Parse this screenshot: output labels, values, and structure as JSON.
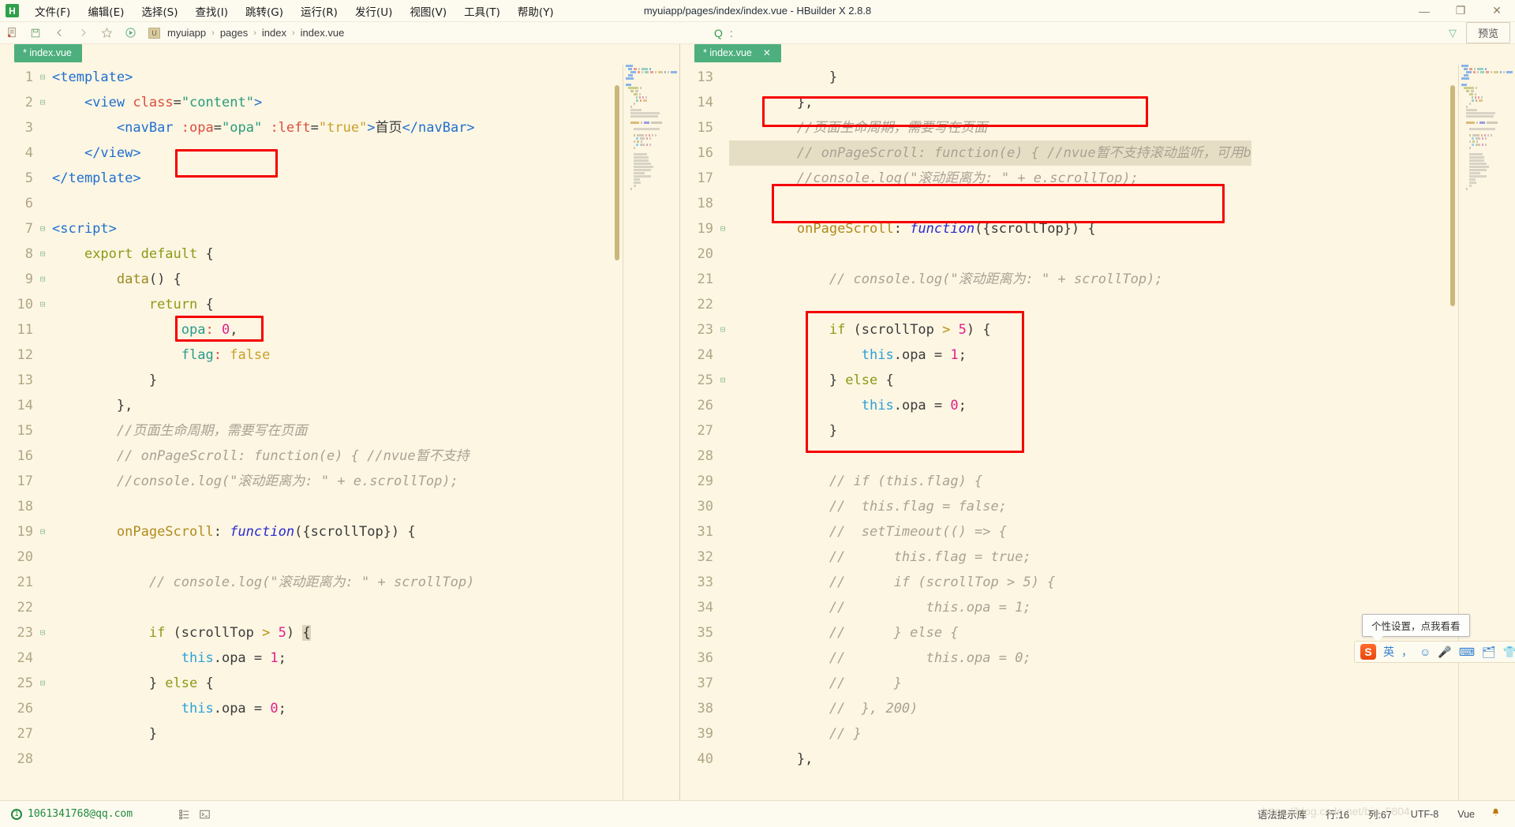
{
  "window": {
    "title": "myuiapp/pages/index/index.vue - HBuilder X 2.8.8",
    "logo_letter": "H",
    "minimize": "—",
    "maximize": "❐",
    "close": "✕"
  },
  "menu": [
    {
      "label": "文件(F)",
      "name": "menu-file"
    },
    {
      "label": "编辑(E)",
      "name": "menu-edit"
    },
    {
      "label": "选择(S)",
      "name": "menu-select"
    },
    {
      "label": "查找(I)",
      "name": "menu-find"
    },
    {
      "label": "跳转(G)",
      "name": "menu-goto"
    },
    {
      "label": "运行(R)",
      "name": "menu-run"
    },
    {
      "label": "发行(U)",
      "name": "menu-publish"
    },
    {
      "label": "视图(V)",
      "name": "menu-view"
    },
    {
      "label": "工具(T)",
      "name": "menu-tools"
    },
    {
      "label": "帮助(Y)",
      "name": "menu-help"
    }
  ],
  "toolbar": {
    "search_glyph": "Q",
    "search_colon": ":",
    "search_colon2": ":",
    "filter_glyph": "▽",
    "preview_label": "预览",
    "breadcrumb": [
      "myuiapp",
      "pages",
      "index",
      "index.vue"
    ],
    "breadcrumb_file_glyph": "U",
    "sep": "›"
  },
  "panes": {
    "left": {
      "tab": {
        "label": "* index.vue",
        "close": ""
      },
      "first_line": 1
    },
    "right": {
      "tab": {
        "label": "* index.vue",
        "close": "✕"
      },
      "first_line": 13
    }
  },
  "left_code": [
    {
      "n": 1,
      "fold": "⊟",
      "tokens": [
        {
          "t": "t-tag",
          "v": "<template>"
        }
      ]
    },
    {
      "n": 2,
      "fold": "⊟",
      "tokens": [
        {
          "t": "t-plain",
          "v": "    "
        },
        {
          "t": "t-tag",
          "v": "<view "
        },
        {
          "t": "t-attr",
          "v": "class"
        },
        {
          "t": "t-plain",
          "v": "="
        },
        {
          "t": "t-str",
          "v": "\"content\""
        },
        {
          "t": "t-tag",
          "v": ">"
        }
      ]
    },
    {
      "n": 3,
      "fold": "",
      "tokens": [
        {
          "t": "t-plain",
          "v": "        "
        },
        {
          "t": "t-tag",
          "v": "<navBar"
        },
        {
          "t": "t-plain",
          "v": " "
        },
        {
          "t": "t-attr",
          "v": ":opa"
        },
        {
          "t": "t-plain",
          "v": "="
        },
        {
          "t": "t-str",
          "v": "\"opa\""
        },
        {
          "t": "t-plain",
          "v": " "
        },
        {
          "t": "t-attr",
          "v": ":left"
        },
        {
          "t": "t-plain",
          "v": "="
        },
        {
          "t": "t-str2",
          "v": "\"true\""
        },
        {
          "t": "t-tag",
          "v": ">"
        },
        {
          "t": "t-plain",
          "v": "首页"
        },
        {
          "t": "t-tag",
          "v": "</navBar>"
        }
      ]
    },
    {
      "n": 4,
      "fold": "",
      "tokens": [
        {
          "t": "t-plain",
          "v": "    "
        },
        {
          "t": "t-tag",
          "v": "</view>"
        }
      ]
    },
    {
      "n": 5,
      "fold": "",
      "tokens": [
        {
          "t": "t-tag",
          "v": "</template>"
        }
      ]
    },
    {
      "n": 6,
      "fold": "",
      "tokens": []
    },
    {
      "n": 7,
      "fold": "⊟",
      "tokens": [
        {
          "t": "t-tag",
          "v": "<script>"
        }
      ]
    },
    {
      "n": 8,
      "fold": "⊟",
      "tokens": [
        {
          "t": "t-plain",
          "v": "    "
        },
        {
          "t": "t-kw",
          "v": "export default"
        },
        {
          "t": "t-plain",
          "v": " {"
        }
      ]
    },
    {
      "n": 9,
      "fold": "⊟",
      "tokens": [
        {
          "t": "t-plain",
          "v": "        "
        },
        {
          "t": "t-kw2",
          "v": "data"
        },
        {
          "t": "t-plain",
          "v": "() {"
        }
      ]
    },
    {
      "n": 10,
      "fold": "⊟",
      "tokens": [
        {
          "t": "t-plain",
          "v": "            "
        },
        {
          "t": "t-kw",
          "v": "return"
        },
        {
          "t": "t-plain",
          "v": " {"
        }
      ]
    },
    {
      "n": 11,
      "fold": "",
      "tokens": [
        {
          "t": "t-plain",
          "v": "                "
        },
        {
          "t": "t-prop",
          "v": "opa"
        },
        {
          "t": "t-attr",
          "v": ":"
        },
        {
          "t": "t-plain",
          "v": " "
        },
        {
          "t": "t-num",
          "v": "0"
        },
        {
          "t": "t-plain",
          "v": ","
        }
      ]
    },
    {
      "n": 12,
      "fold": "",
      "tokens": [
        {
          "t": "t-plain",
          "v": "                "
        },
        {
          "t": "t-prop",
          "v": "flag"
        },
        {
          "t": "t-attr",
          "v": ":"
        },
        {
          "t": "t-plain",
          "v": " "
        },
        {
          "t": "t-str2",
          "v": "false"
        }
      ]
    },
    {
      "n": 13,
      "fold": "",
      "tokens": [
        {
          "t": "t-plain",
          "v": "            }"
        }
      ]
    },
    {
      "n": 14,
      "fold": "",
      "tokens": [
        {
          "t": "t-plain",
          "v": "        },"
        }
      ]
    },
    {
      "n": 15,
      "fold": "",
      "tokens": [
        {
          "t": "t-com",
          "v": "        //页面生命周期，需要写在页面"
        }
      ]
    },
    {
      "n": 16,
      "fold": "",
      "tokens": [
        {
          "t": "t-com",
          "v": "        // onPageScroll: function(e) { //nvue暂不支持"
        }
      ]
    },
    {
      "n": 17,
      "fold": "",
      "tokens": [
        {
          "t": "t-com",
          "v": "        //console.log(\"滚动距离为: \" + e.scrollTop);"
        }
      ]
    },
    {
      "n": 18,
      "fold": "",
      "tokens": []
    },
    {
      "n": 19,
      "fold": "⊟",
      "tokens": [
        {
          "t": "t-plain",
          "v": "        "
        },
        {
          "t": "t-fn",
          "v": "onPageScroll"
        },
        {
          "t": "t-plain",
          "v": ": "
        },
        {
          "t": "t-fnkw",
          "v": "function"
        },
        {
          "t": "t-plain",
          "v": "({scrollTop}) {"
        }
      ]
    },
    {
      "n": 20,
      "fold": "",
      "tokens": []
    },
    {
      "n": 21,
      "fold": "",
      "tokens": [
        {
          "t": "t-com",
          "v": "            // console.log(\"滚动距离为: \" + scrollTop)"
        }
      ]
    },
    {
      "n": 22,
      "fold": "",
      "tokens": []
    },
    {
      "n": 23,
      "fold": "⊟",
      "tokens": [
        {
          "t": "t-plain",
          "v": "            "
        },
        {
          "t": "t-kw",
          "v": "if"
        },
        {
          "t": "t-plain",
          "v": " (scrollTop "
        },
        {
          "t": "t-op",
          "v": ">"
        },
        {
          "t": "t-plain",
          "v": " "
        },
        {
          "t": "t-num",
          "v": "5"
        },
        {
          "t": "t-plain",
          "v": ") "
        },
        {
          "t": "curs-blk",
          "v": "{"
        }
      ]
    },
    {
      "n": 24,
      "fold": "",
      "tokens": [
        {
          "t": "t-plain",
          "v": "                "
        },
        {
          "t": "t-this",
          "v": "this"
        },
        {
          "t": "t-plain",
          "v": ".opa = "
        },
        {
          "t": "t-num",
          "v": "1"
        },
        {
          "t": "t-plain",
          "v": ";"
        }
      ]
    },
    {
      "n": 25,
      "fold": "⊟",
      "tokens": [
        {
          "t": "t-plain",
          "v": "            } "
        },
        {
          "t": "t-kw",
          "v": "else"
        },
        {
          "t": "t-plain",
          "v": " {"
        }
      ]
    },
    {
      "n": 26,
      "fold": "",
      "tokens": [
        {
          "t": "t-plain",
          "v": "                "
        },
        {
          "t": "t-this",
          "v": "this"
        },
        {
          "t": "t-plain",
          "v": ".opa = "
        },
        {
          "t": "t-num",
          "v": "0"
        },
        {
          "t": "t-plain",
          "v": ";"
        }
      ]
    },
    {
      "n": 27,
      "fold": "",
      "tokens": [
        {
          "t": "t-plain",
          "v": "            }"
        }
      ]
    },
    {
      "n": 28,
      "fold": "",
      "tokens": []
    }
  ],
  "right_code": [
    {
      "n": 13,
      "fold": "",
      "hl": false,
      "tokens": [
        {
          "t": "t-plain",
          "v": "            }"
        }
      ]
    },
    {
      "n": 14,
      "fold": "",
      "hl": false,
      "tokens": [
        {
          "t": "t-plain",
          "v": "        },"
        }
      ]
    },
    {
      "n": 15,
      "fold": "",
      "hl": false,
      "tokens": [
        {
          "t": "t-com",
          "v": "        //页面生命周期，需要写在页面"
        }
      ]
    },
    {
      "n": 16,
      "fold": "",
      "hl": true,
      "tokens": [
        {
          "t": "t-com",
          "v": "        // onPageScroll: function(e) { //nvue暂不支持滚动监听，可用b"
        }
      ]
    },
    {
      "n": 17,
      "fold": "",
      "hl": false,
      "tokens": [
        {
          "t": "t-com",
          "v": "        //console.log(\"滚动距离为: \" + e.scrollTop);"
        }
      ]
    },
    {
      "n": 18,
      "fold": "",
      "hl": false,
      "tokens": []
    },
    {
      "n": 19,
      "fold": "⊟",
      "hl": false,
      "tokens": [
        {
          "t": "t-plain",
          "v": "        "
        },
        {
          "t": "t-fn",
          "v": "onPageScroll"
        },
        {
          "t": "t-plain",
          "v": ": "
        },
        {
          "t": "t-fnkw",
          "v": "function"
        },
        {
          "t": "t-plain",
          "v": "({scrollTop}) {"
        }
      ]
    },
    {
      "n": 20,
      "fold": "",
      "hl": false,
      "tokens": []
    },
    {
      "n": 21,
      "fold": "",
      "hl": false,
      "tokens": [
        {
          "t": "t-com",
          "v": "            // console.log(\"滚动距离为: \" + scrollTop);"
        }
      ]
    },
    {
      "n": 22,
      "fold": "",
      "hl": false,
      "tokens": []
    },
    {
      "n": 23,
      "fold": "⊟",
      "hl": false,
      "tokens": [
        {
          "t": "t-plain",
          "v": "            "
        },
        {
          "t": "t-kw",
          "v": "if"
        },
        {
          "t": "t-plain",
          "v": " (scrollTop "
        },
        {
          "t": "t-op",
          "v": ">"
        },
        {
          "t": "t-plain",
          "v": " "
        },
        {
          "t": "t-num",
          "v": "5"
        },
        {
          "t": "t-plain",
          "v": ") {"
        }
      ]
    },
    {
      "n": 24,
      "fold": "",
      "hl": false,
      "tokens": [
        {
          "t": "t-plain",
          "v": "                "
        },
        {
          "t": "t-this",
          "v": "this"
        },
        {
          "t": "t-plain",
          "v": ".opa = "
        },
        {
          "t": "t-num",
          "v": "1"
        },
        {
          "t": "t-plain",
          "v": ";"
        }
      ]
    },
    {
      "n": 25,
      "fold": "⊟",
      "hl": false,
      "tokens": [
        {
          "t": "t-plain",
          "v": "            } "
        },
        {
          "t": "t-kw",
          "v": "else"
        },
        {
          "t": "t-plain",
          "v": " {"
        }
      ]
    },
    {
      "n": 26,
      "fold": "",
      "hl": false,
      "tokens": [
        {
          "t": "t-plain",
          "v": "                "
        },
        {
          "t": "t-this",
          "v": "this"
        },
        {
          "t": "t-plain",
          "v": ".opa = "
        },
        {
          "t": "t-num",
          "v": "0"
        },
        {
          "t": "t-plain",
          "v": ";"
        }
      ]
    },
    {
      "n": 27,
      "fold": "",
      "hl": false,
      "tokens": [
        {
          "t": "t-plain",
          "v": "            }"
        }
      ]
    },
    {
      "n": 28,
      "fold": "",
      "hl": false,
      "tokens": []
    },
    {
      "n": 29,
      "fold": "",
      "hl": false,
      "tokens": [
        {
          "t": "t-com",
          "v": "            // if (this.flag) {"
        }
      ]
    },
    {
      "n": 30,
      "fold": "",
      "hl": false,
      "tokens": [
        {
          "t": "t-com",
          "v": "            //  this.flag = false;"
        }
      ]
    },
    {
      "n": 31,
      "fold": "",
      "hl": false,
      "tokens": [
        {
          "t": "t-com",
          "v": "            //  setTimeout(() => {"
        }
      ]
    },
    {
      "n": 32,
      "fold": "",
      "hl": false,
      "tokens": [
        {
          "t": "t-com",
          "v": "            //      this.flag = true;"
        }
      ]
    },
    {
      "n": 33,
      "fold": "",
      "hl": false,
      "tokens": [
        {
          "t": "t-com",
          "v": "            //      if (scrollTop > 5) {"
        }
      ]
    },
    {
      "n": 34,
      "fold": "",
      "hl": false,
      "tokens": [
        {
          "t": "t-com",
          "v": "            //          this.opa = 1;"
        }
      ]
    },
    {
      "n": 35,
      "fold": "",
      "hl": false,
      "tokens": [
        {
          "t": "t-com",
          "v": "            //      } else {"
        }
      ]
    },
    {
      "n": 36,
      "fold": "",
      "hl": false,
      "tokens": [
        {
          "t": "t-com",
          "v": "            //          this.opa = 0;"
        }
      ]
    },
    {
      "n": 37,
      "fold": "",
      "hl": false,
      "tokens": [
        {
          "t": "t-com",
          "v": "            //      }"
        }
      ]
    },
    {
      "n": 38,
      "fold": "",
      "hl": false,
      "tokens": [
        {
          "t": "t-com",
          "v": "            //  }, 200)"
        }
      ]
    },
    {
      "n": 39,
      "fold": "",
      "hl": false,
      "tokens": [
        {
          "t": "t-com",
          "v": "            // }"
        }
      ]
    },
    {
      "n": 40,
      "fold": "",
      "hl": false,
      "tokens": [
        {
          "t": "t-plain",
          "v": "        },"
        }
      ]
    }
  ],
  "statusbar": {
    "account": "1061341768@qq.com",
    "account_icon": "①",
    "outline_icon": "list-icon",
    "terminal_icon": "terminal-icon",
    "syntax_lib": "语法提示库",
    "line": "行:16",
    "column": "列:67",
    "encoding": "UTF-8",
    "language": "Vue",
    "bell": "🔔"
  },
  "ime": {
    "tip": "个性设置，点我看看",
    "logo": "S",
    "mode": "英",
    "items": [
      "，",
      "☺",
      "🎤",
      "⌨",
      "🗂",
      "👕",
      "▦"
    ]
  },
  "watermark": "https://blog.csdn.net/bin_5804",
  "colors": {
    "editor_bg": "#fdf6e3",
    "tab_active": "#4caf7d",
    "annotation_red": "#f50000",
    "linenum": "#b0a684",
    "comment": "#a9a294"
  }
}
